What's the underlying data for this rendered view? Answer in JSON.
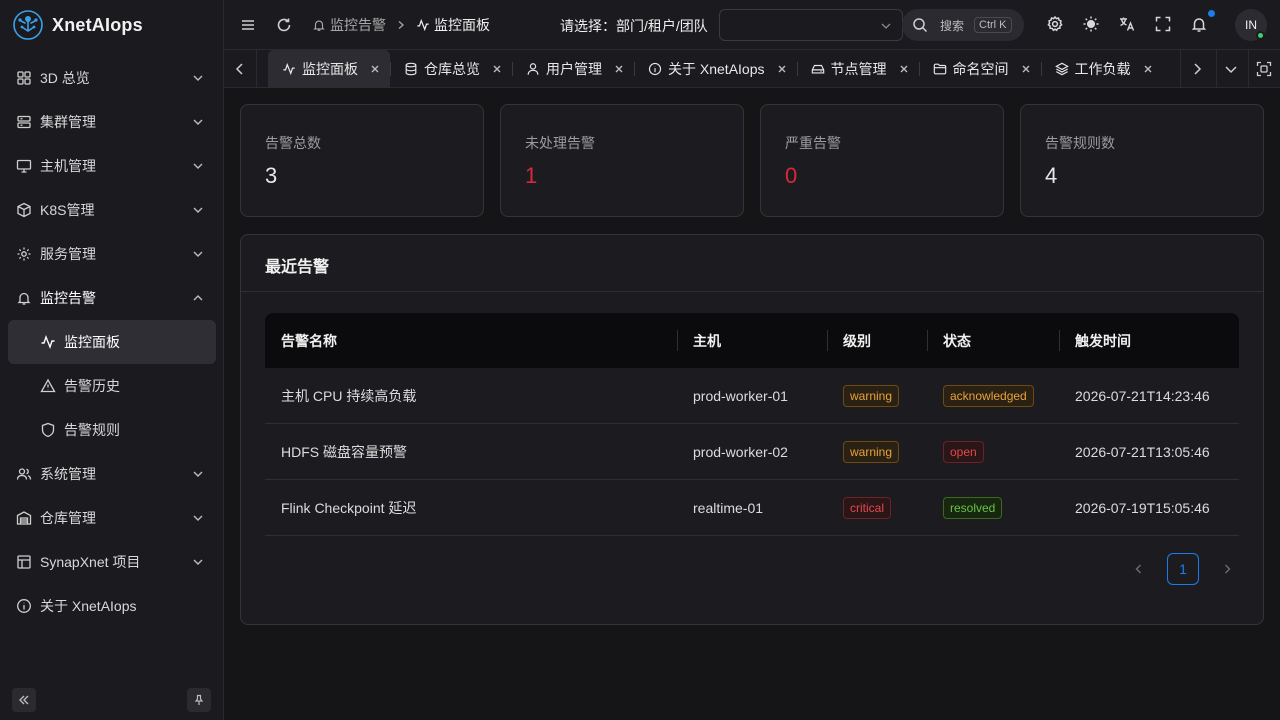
{
  "app": {
    "name": "XnetAIops"
  },
  "sidebar": {
    "items": [
      {
        "label": "3D 总览",
        "icon": "grid-icon"
      },
      {
        "label": "集群管理",
        "icon": "server-icon"
      },
      {
        "label": "主机管理",
        "icon": "monitor-icon"
      },
      {
        "label": "K8S管理",
        "icon": "cube-icon"
      },
      {
        "label": "服务管理",
        "icon": "gear-icon"
      },
      {
        "label": "监控告警",
        "icon": "bell-icon"
      },
      {
        "label": "监控面板",
        "icon": "activity-icon"
      },
      {
        "label": "告警历史",
        "icon": "warning-icon"
      },
      {
        "label": "告警规则",
        "icon": "shield-icon"
      },
      {
        "label": "系统管理",
        "icon": "users-icon"
      },
      {
        "label": "仓库管理",
        "icon": "warehouse-icon"
      },
      {
        "label": "SynapXnet 项目",
        "icon": "layout-icon"
      },
      {
        "label": "关于 XnetAIops",
        "icon": "info-icon"
      }
    ]
  },
  "header": {
    "breadcrumb": [
      "监控告警",
      "监控面板"
    ],
    "scope_label": "请选择：部门/租户/团队",
    "scope_value": "",
    "search_placeholder": "搜索",
    "search_shortcut": "Ctrl K",
    "avatar": "IN",
    "colors": {
      "accent": "#1e7ce8",
      "online": "#3fcf6a"
    }
  },
  "tabs": [
    {
      "label": "监控面板",
      "icon": "activity-icon",
      "active": true
    },
    {
      "label": "仓库总览",
      "icon": "database-icon"
    },
    {
      "label": "用户管理",
      "icon": "user-icon"
    },
    {
      "label": "关于 XnetAIops",
      "icon": "info-icon"
    },
    {
      "label": "节点管理",
      "icon": "drive-icon"
    },
    {
      "label": "命名空间",
      "icon": "folder-icon"
    },
    {
      "label": "工作负载",
      "icon": "layers-icon"
    }
  ],
  "stats": [
    {
      "label": "告警总数",
      "value": "3"
    },
    {
      "label": "未处理告警",
      "value": "1"
    },
    {
      "label": "严重告警",
      "value": "0"
    },
    {
      "label": "告警规则数",
      "value": "4"
    }
  ],
  "recent": {
    "title": "最近告警",
    "columns": [
      "告警名称",
      "主机",
      "级别",
      "状态",
      "触发时间"
    ],
    "rows": [
      {
        "name": "主机 CPU 持续高负载",
        "host": "prod-worker-01",
        "level": "warning",
        "status": "acknowledged",
        "time": "2026-07-21T14:23:46"
      },
      {
        "name": "HDFS 磁盘容量预警",
        "host": "prod-worker-02",
        "level": "warning",
        "status": "open",
        "time": "2026-07-21T13:05:46"
      },
      {
        "name": "Flink Checkpoint 延迟",
        "host": "realtime-01",
        "level": "critical",
        "status": "resolved",
        "time": "2026-07-19T15:05:46"
      }
    ],
    "page": "1"
  }
}
